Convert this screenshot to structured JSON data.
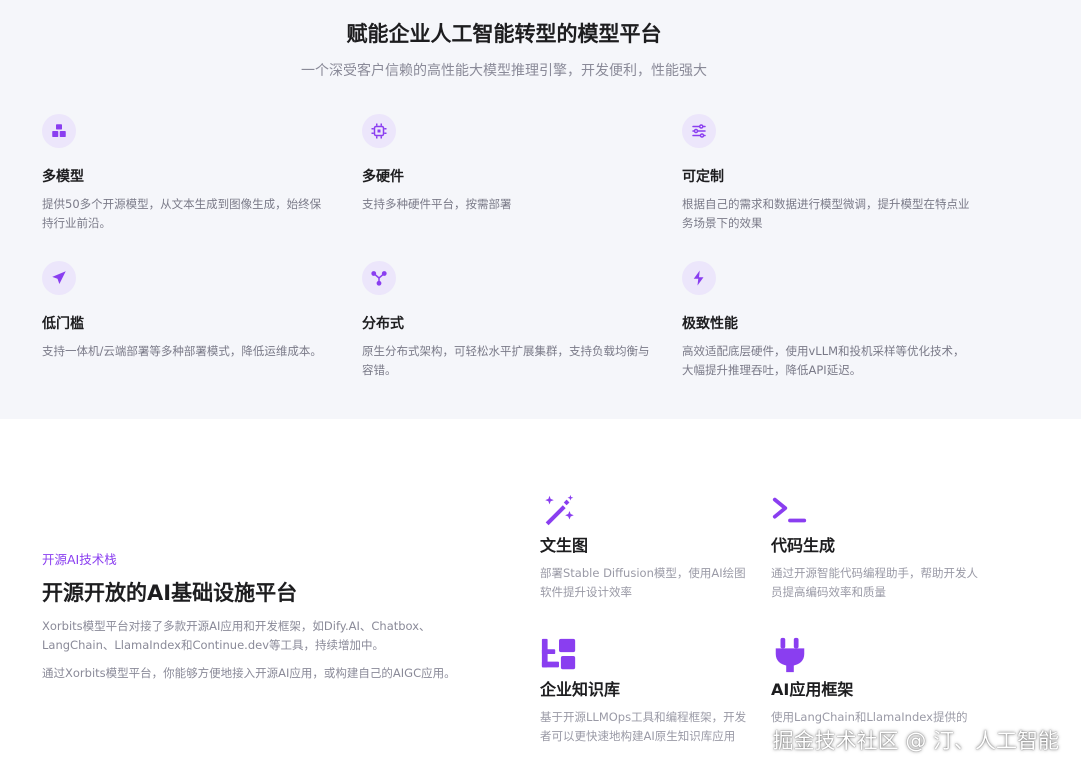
{
  "hero": {
    "title": "赋能企业人工智能转型的模型平台",
    "subtitle": "一个深受客户信赖的高性能大模型推理引擎，开发便利，性能强大"
  },
  "features": [
    {
      "icon": "cube-stack-icon",
      "title": "多模型",
      "desc": "提供50多个开源模型，从文本生成到图像生成，始终保持行业前沿。"
    },
    {
      "icon": "chip-icon",
      "title": "多硬件",
      "desc": "支持多种硬件平台，按需部署"
    },
    {
      "icon": "sliders-icon",
      "title": "可定制",
      "desc": "根据自己的需求和数据进行模型微调，提升模型在特点业务场景下的效果"
    },
    {
      "icon": "paper-plane-icon",
      "title": "低门槛",
      "desc": "支持一体机/云端部署等多种部署模式，降低运维成本。"
    },
    {
      "icon": "network-icon",
      "title": "分布式",
      "desc": "原生分布式架构，可轻松水平扩展集群，支持负载均衡与容错。"
    },
    {
      "icon": "lightning-icon",
      "title": "极致性能",
      "desc": "高效适配底层硬件，使用vLLM和投机采样等优化技术，大幅提升推理吞吐，降低API延迟。"
    }
  ],
  "stack": {
    "kicker": "开源AI技术栈",
    "title": "开源开放的AI基础设施平台",
    "p1": "Xorbits模型平台对接了多款开源AI应用和开发框架，如Dify.AI、Chatbox、LangChain、LlamaIndex和Continue.dev等工具，持续增加中。",
    "p2": "通过Xorbits模型平台，你能够方便地接入开源AI应用，或构建自己的AIGC应用。"
  },
  "cards": [
    {
      "icon": "magic-wand-icon",
      "title": "文生图",
      "desc": "部署Stable Diffusion模型，使用AI绘图软件提升设计效率"
    },
    {
      "icon": "terminal-icon",
      "title": "代码生成",
      "desc": "通过开源智能代码编程助手，帮助开发人员提高编码效率和质量"
    },
    {
      "icon": "knowledge-base-icon",
      "title": "企业知识库",
      "desc": "基于开源LLMOps工具和编程框架，开发者可以更快速地构建AI原生知识库应用"
    },
    {
      "icon": "plug-icon",
      "title": "AI应用框架",
      "desc": "使用LangChain和LlamaIndex提供的"
    }
  ],
  "watermark": "掘金技术社区 @ 汀、人工智能",
  "colors": {
    "accent": "#8a3ef0",
    "icon_bg": "#ece6fb",
    "section_bg": "#f5f6fa"
  }
}
